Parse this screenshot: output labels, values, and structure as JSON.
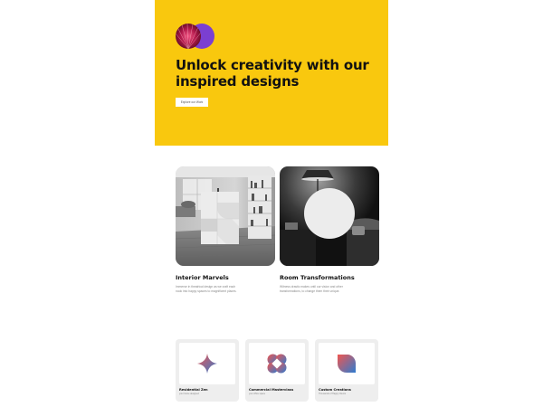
{
  "hero": {
    "title": "Unlock creativity with our inspired designs",
    "cta_label": "Explore our Work",
    "background_color": "#f9c80e",
    "avatar_colors": [
      "#8a1d3c",
      "#7b3fd1"
    ]
  },
  "features": [
    {
      "title": "Interior Marvels",
      "description": "Immerse in theatrical design as we craft each nook into happy spaces to magnificent places.",
      "image": "grayscale-interior-photo-with-abstract-shape"
    },
    {
      "title": "Room Transformations",
      "description": "Witness drastic makes until our vision and other transformations, to change them their unique.",
      "image": "grayscale-bedroom-photo-with-circle"
    }
  ],
  "services": [
    {
      "title": "Residential Zen",
      "subtitle": "your future designed",
      "icon": "four-point-star-icon"
    },
    {
      "title": "Commercial Masterclass",
      "subtitle": "your office space",
      "icon": "quatrefoil-icon"
    },
    {
      "title": "Custom Creations",
      "subtitle": "Thousands of Happy Clients",
      "icon": "leaf-icon"
    }
  ],
  "colors": {
    "gradient_start": "#f0564f",
    "gradient_end": "#2f7bd0"
  }
}
